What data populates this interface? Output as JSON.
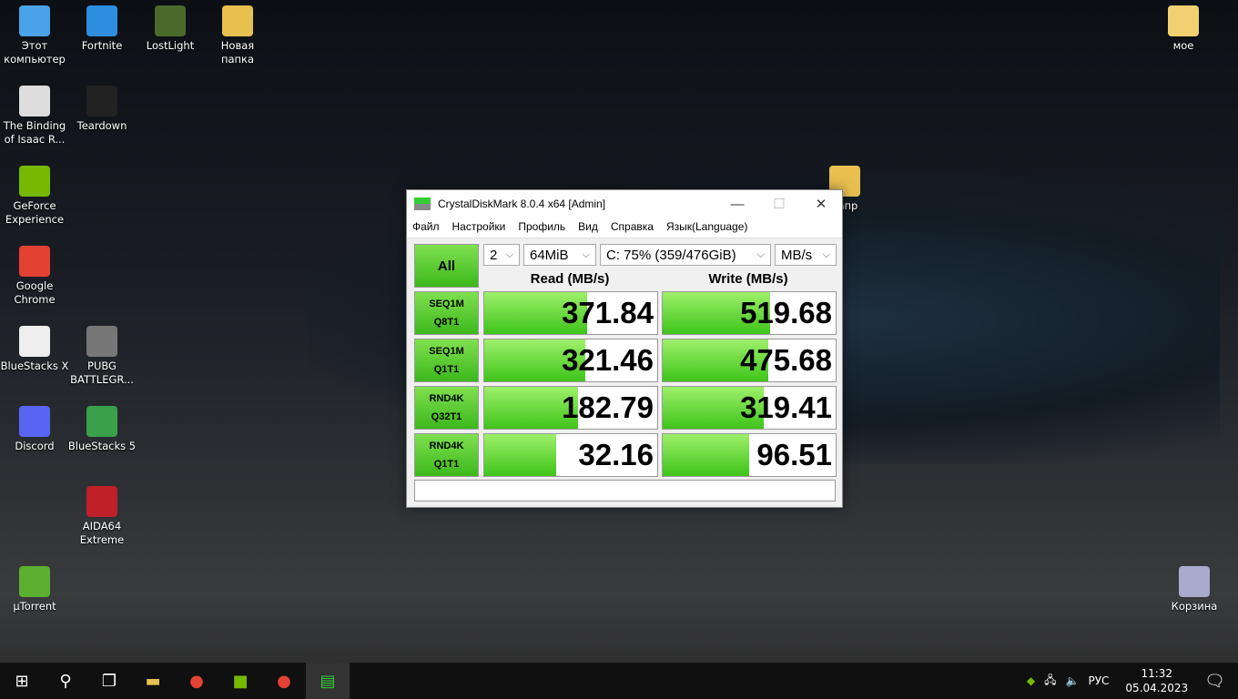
{
  "desktop": {
    "icons": [
      {
        "label": "Этот компьютер",
        "color": "#4aa3e8"
      },
      {
        "label": "Fortnite",
        "color": "#2d8ee0"
      },
      {
        "label": "LostLight",
        "color": "#4a6a2a"
      },
      {
        "label": "Новая папка",
        "color": "#e8c050"
      },
      {
        "label": "The Binding of Isaac R...",
        "color": "#ddd"
      },
      {
        "label": "Teardown",
        "color": "#222"
      },
      {
        "label": "GeForce Experience",
        "color": "#76b900"
      },
      {
        "label": "Google Chrome",
        "color": "#e34133"
      },
      {
        "label": "BlueStacks X",
        "color": "#eee"
      },
      {
        "label": "PUBG BATTLEGR...",
        "color": "#777"
      },
      {
        "label": "Discord",
        "color": "#5865f2"
      },
      {
        "label": "BlueStacks 5",
        "color": "#3aa04a"
      },
      {
        "label": "AIDA64 Extreme",
        "color": "#c0202a"
      },
      {
        "label": "µTorrent",
        "color": "#5cb030"
      },
      {
        "label": "мое",
        "color": "#f0d070"
      },
      {
        "label": "вапр",
        "color": "#e8c050"
      },
      {
        "label": "Корзина",
        "color": "#aac"
      }
    ]
  },
  "window": {
    "title": "CrystalDiskMark 8.0.4 x64 [Admin]",
    "menu": [
      "Файл",
      "Настройки",
      "Профиль",
      "Вид",
      "Справка",
      "Язык(Language)"
    ],
    "all_label": "All",
    "count": "2",
    "size": "64MiB",
    "drive": "C: 75% (359/476GiB)",
    "unit": "MB/s",
    "read_header": "Read (MB/s)",
    "write_header": "Write (MB/s)",
    "rows": [
      {
        "l1": "SEQ1M",
        "l2": "Q8T1",
        "read": "371.84",
        "write": "519.68"
      },
      {
        "l1": "SEQ1M",
        "l2": "Q1T1",
        "read": "321.46",
        "write": "475.68"
      },
      {
        "l1": "RND4K",
        "l2": "Q32T1",
        "read": "182.79",
        "write": "319.41"
      },
      {
        "l1": "RND4K",
        "l2": "Q1T1",
        "read": "32.16",
        "write": "96.51"
      }
    ],
    "status": ""
  },
  "taskbar": {
    "lang": "РУС",
    "time": "11:32",
    "date": "05.04.2023"
  }
}
